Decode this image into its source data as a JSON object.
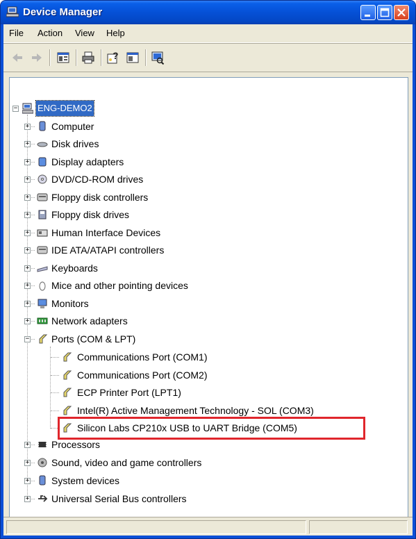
{
  "window": {
    "title": "Device Manager"
  },
  "menu": {
    "file": "File",
    "action": "Action",
    "view": "View",
    "help": "Help"
  },
  "toolbar": [
    "back-icon",
    "forward-icon",
    "properties-icon",
    "print-icon",
    "help-icon",
    "view-icon",
    "scan-hardware-icon"
  ],
  "tree": {
    "root": "ENG-DEMO2",
    "categories": [
      {
        "label": "Computer"
      },
      {
        "label": "Disk drives"
      },
      {
        "label": "Display adapters"
      },
      {
        "label": "DVD/CD-ROM drives"
      },
      {
        "label": "Floppy disk controllers"
      },
      {
        "label": "Floppy disk drives"
      },
      {
        "label": "Human Interface Devices"
      },
      {
        "label": "IDE ATA/ATAPI controllers"
      },
      {
        "label": "Keyboards"
      },
      {
        "label": "Mice and other pointing devices"
      },
      {
        "label": "Monitors"
      },
      {
        "label": "Network adapters"
      },
      {
        "label": "Ports (COM & LPT)"
      },
      {
        "label": "Processors"
      },
      {
        "label": "Sound, video and game controllers"
      },
      {
        "label": "System devices"
      },
      {
        "label": "Universal Serial Bus controllers"
      }
    ],
    "ports": [
      {
        "label": "Communications Port (COM1)"
      },
      {
        "label": "Communications Port (COM2)"
      },
      {
        "label": "ECP Printer Port (LPT1)"
      },
      {
        "label": "Intel(R) Active Management Technology - SOL (COM3)"
      },
      {
        "label": "Silicon Labs CP210x USB to UART Bridge (COM5)"
      }
    ]
  },
  "colors": {
    "titlebar": "#0550d6",
    "selection": "#316ac5",
    "highlight": "#e0262c"
  }
}
